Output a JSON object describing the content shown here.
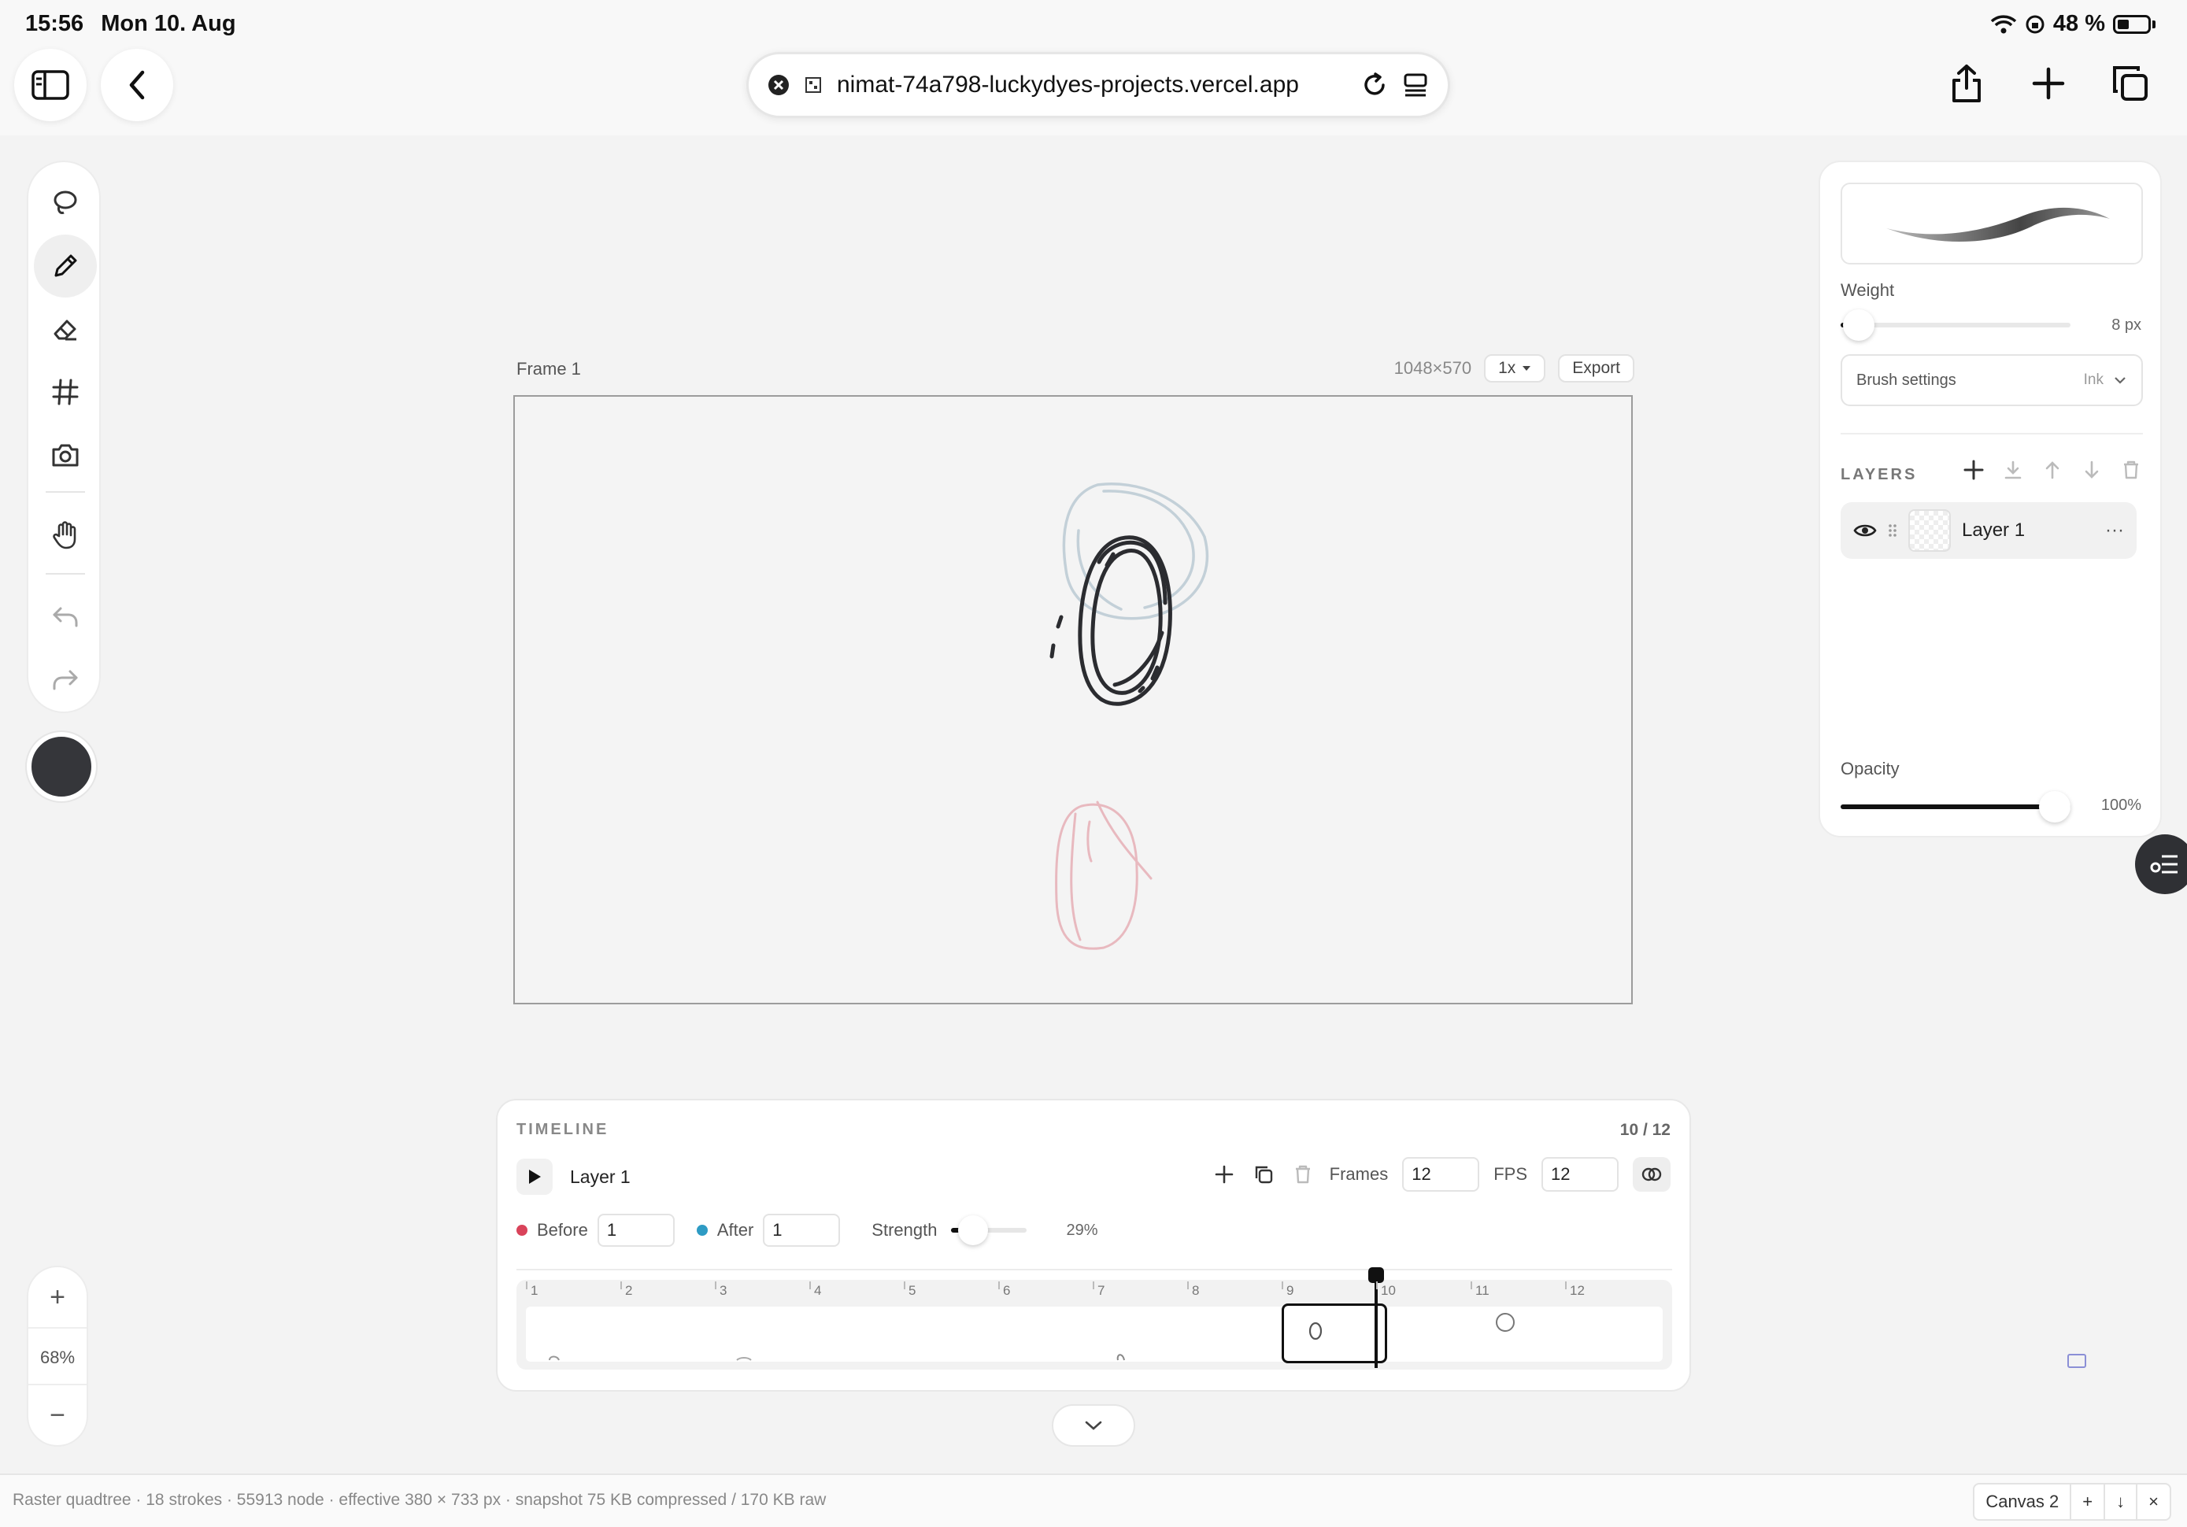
{
  "status_bar": {
    "time": "15:56",
    "date": "Mon 10. Aug",
    "battery": "48 %"
  },
  "browser": {
    "url": "nimat-74a798-luckydyes-projects.vercel.app"
  },
  "zoom": {
    "plus": "+",
    "value": "68%",
    "minus": "−"
  },
  "canvas": {
    "frame_label": "Frame 1",
    "dimensions": "1048×570",
    "scale": "1x",
    "export": "Export"
  },
  "right_panel": {
    "weight_label": "Weight",
    "weight_value": "8 px",
    "weight_level": 0.08,
    "brush_settings_label": "Brush settings",
    "brush_type": "Ink",
    "layers_title": "LAYERS",
    "layers": [
      {
        "name": "Layer 1"
      }
    ],
    "opacity_label": "Opacity",
    "opacity_value": "100%",
    "opacity_level": 1.0
  },
  "timeline": {
    "title": "TIMELINE",
    "counter": "10 / 12",
    "layer_name": "Layer 1",
    "frames_label": "Frames",
    "frames_value": "12",
    "fps_label": "FPS",
    "fps_value": "12",
    "before_label": "Before",
    "before_value": "1",
    "after_label": "After",
    "after_value": "1",
    "strength_label": "Strength",
    "strength_value": "29%",
    "strength_level": 0.29,
    "ticks": [
      "1",
      "2",
      "3",
      "4",
      "5",
      "6",
      "7",
      "8",
      "9",
      "10",
      "11",
      "12"
    ],
    "current_frame": 10
  },
  "footer": {
    "info": "Raster quadtree · 18 strokes · 55913 node · effective 380 × 733 px · snapshot 75 KB compressed / 170 KB raw",
    "canvas_name": "Canvas 2",
    "add": "+",
    "download": "↓",
    "close": "×"
  },
  "colors": {
    "stroke_color": "#35363a",
    "before_color": "#d9435a",
    "after_color": "#2e9bc4"
  }
}
